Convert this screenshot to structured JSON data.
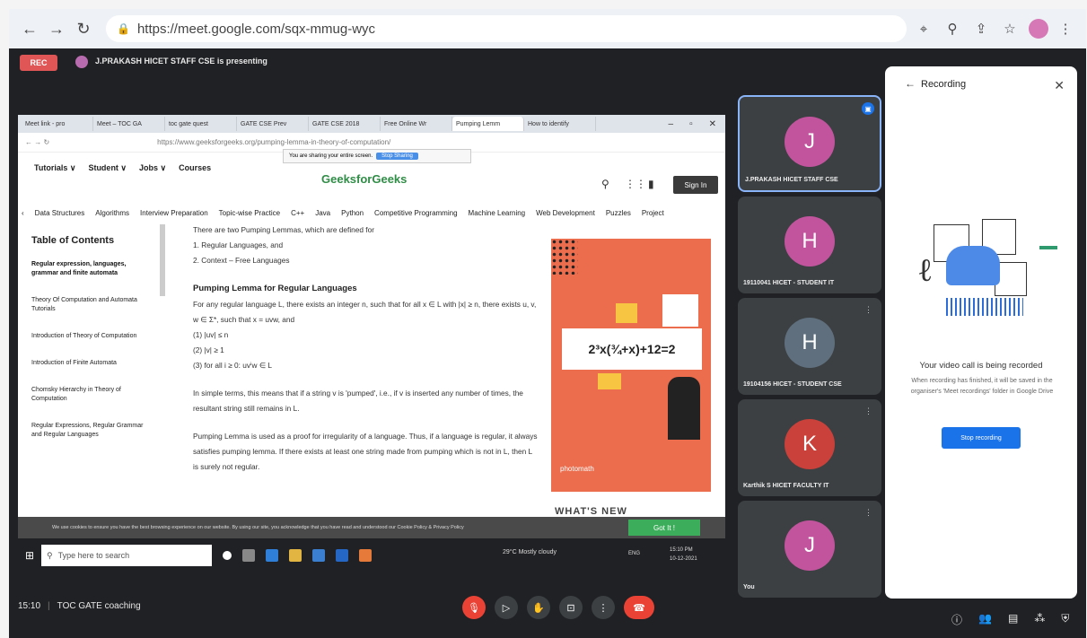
{
  "browser": {
    "url": "https://meet.google.com/sqx-mmug-wyc",
    "icons": [
      "back-arrow-icon",
      "forward-arrow-icon",
      "reload-icon",
      "lock-icon",
      "lens-icon",
      "zoom-icon",
      "share-icon",
      "star-icon",
      "profile-icon",
      "kebab-menu-icon"
    ]
  },
  "meet": {
    "rec_label": "REC",
    "presenting_text": "J.PRAKASH HICET STAFF CSE is presenting",
    "meeting_time": "15:10",
    "meeting_name": "TOC GATE coaching"
  },
  "shared_screen": {
    "tabs": [
      "Meet link - pro",
      "Meet – TOC GA",
      "toc gate quest",
      "GATE CSE Prev",
      "GATE CSE 2018",
      "Free Online Wr",
      "Pumping Lemm",
      "How to identify"
    ],
    "address": "https://www.geeksforgeeks.org/pumping-lemma-in-theory-of-computation/",
    "sharing_notice": "You are sharing your entire screen.",
    "stop_sharing": "Stop Sharing",
    "gfg_nav": [
      "Tutorials ∨",
      "Student ∨",
      "Jobs ∨",
      "Courses"
    ],
    "logo": "GeeksforGeeks",
    "sign_in": "Sign In",
    "categories": [
      "Data Structures",
      "Algorithms",
      "Interview Preparation",
      "Topic-wise Practice",
      "C++",
      "Java",
      "Python",
      "Competitive Programming",
      "Machine Learning",
      "Web Development",
      "Puzzles",
      "Project"
    ],
    "toc_title": "Table of Contents",
    "toc_items": [
      "Regular expression, languages, grammar and finite automata",
      "Theory Of Computation and Automata Tutorials",
      "Introduction of Theory of Computation",
      "Introduction of Finite Automata",
      "Chomsky Hierarchy in Theory of Computation",
      "Regular Expressions, Regular Grammar and Regular Languages"
    ],
    "article": {
      "intro": "There are two Pumping Lemmas, which are defined for",
      "list": [
        "1. Regular Languages, and",
        "2. Context – Free Languages"
      ],
      "heading": "Pumping Lemma for Regular Languages",
      "p1": "For any regular language L, there exists an integer n, such that for all x ∈ L with |x| ≥ n, there exists u, v, w ∈ Σ*, such that x = uvw, and",
      "conds": [
        "(1) |uv| ≤ n",
        "(2) |v| ≥ 1",
        "(3) for all i ≥ 0: uvⁱw ∈ L"
      ],
      "p2": "In simple terms, this means that if a string v is 'pumped', i.e., if v is inserted any number of times, the resultant string still remains in L.",
      "p3": "Pumping Lemma is used as a proof for irregularity of a language. Thus, if a language is regular, it always satisfies pumping lemma. If there exists at least one string made from pumping which is not in L, then L is surely not regular."
    },
    "ad_equation": "2³x(¾+x)+12=2",
    "ad_footer": "photomath",
    "whats_new": "WHAT'S NEW",
    "cookie_text": "We use cookies to ensure you have the best browsing experience on our website. By using our site, you acknowledge that you have read and understood our Cookie Policy & Privacy Policy",
    "got_it": "Got It !",
    "taskbar": {
      "search_placeholder": "Type here to search",
      "weather": "29°C  Mostly cloudy",
      "time": "15:10 PM",
      "date": "10-12-2021",
      "lang": "ENG"
    }
  },
  "participants": [
    {
      "initial": "J",
      "name": "J.PRAKASH HICET STAFF CSE",
      "color": "#c2549e"
    },
    {
      "initial": "H",
      "name": "19110041 HICET - STUDENT IT",
      "color": "#c2549e"
    },
    {
      "initial": "H",
      "name": "19104156 HICET - STUDENT CSE",
      "color": "#5f6f7d"
    },
    {
      "initial": "K",
      "name": "Karthik S HICET FACULTY IT",
      "color": "#c9413a"
    },
    {
      "initial": "J",
      "name": "You",
      "color": "#c2549e"
    }
  ],
  "recording_panel": {
    "title": "Recording",
    "status": "Your video call is being recorded",
    "description": "When recording has finished, it will be saved in the organiser's 'Meet recordings' folder in Google Drive",
    "stop_button": "Stop recording"
  }
}
